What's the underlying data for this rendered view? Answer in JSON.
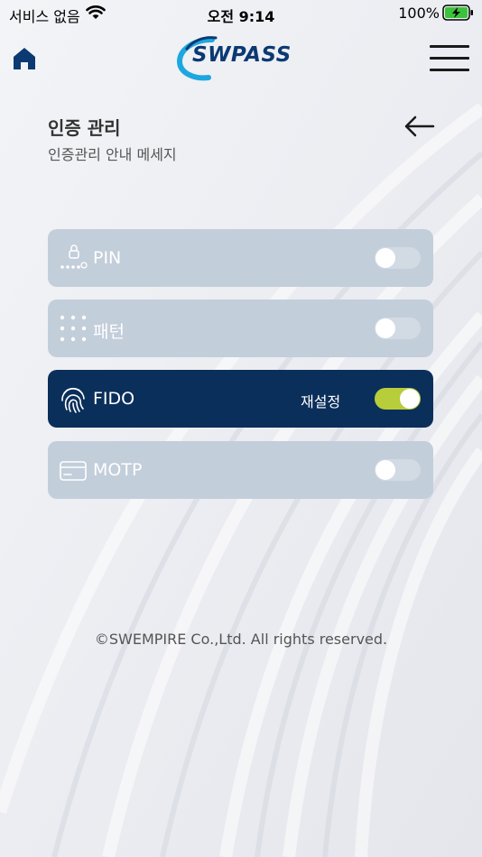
{
  "status_bar": {
    "carrier": "서비스 없음",
    "time": "오전 9:14",
    "battery": "100%"
  },
  "header": {
    "logo_text": "SWPASS"
  },
  "page": {
    "title": "인증 관리",
    "subtitle": "인증관리 안내 메세지"
  },
  "auth_methods": [
    {
      "label": "PIN",
      "icon": "pin-lock-icon",
      "enabled": false
    },
    {
      "label": "패턴",
      "icon": "pattern-grid-icon",
      "enabled": false
    },
    {
      "label": "FIDO",
      "icon": "fingerprint-icon",
      "enabled": true,
      "action": "재설정"
    },
    {
      "label": "MOTP",
      "icon": "card-icon",
      "enabled": false
    }
  ],
  "footer": {
    "copyright": "©SWEMPIRE Co.,Ltd. All rights reserved."
  },
  "colors": {
    "active_row": "#0b2f5b",
    "inactive_row": "#c3cedb",
    "toggle_on": "#b8cd3a",
    "brand": "#0b3a73"
  }
}
